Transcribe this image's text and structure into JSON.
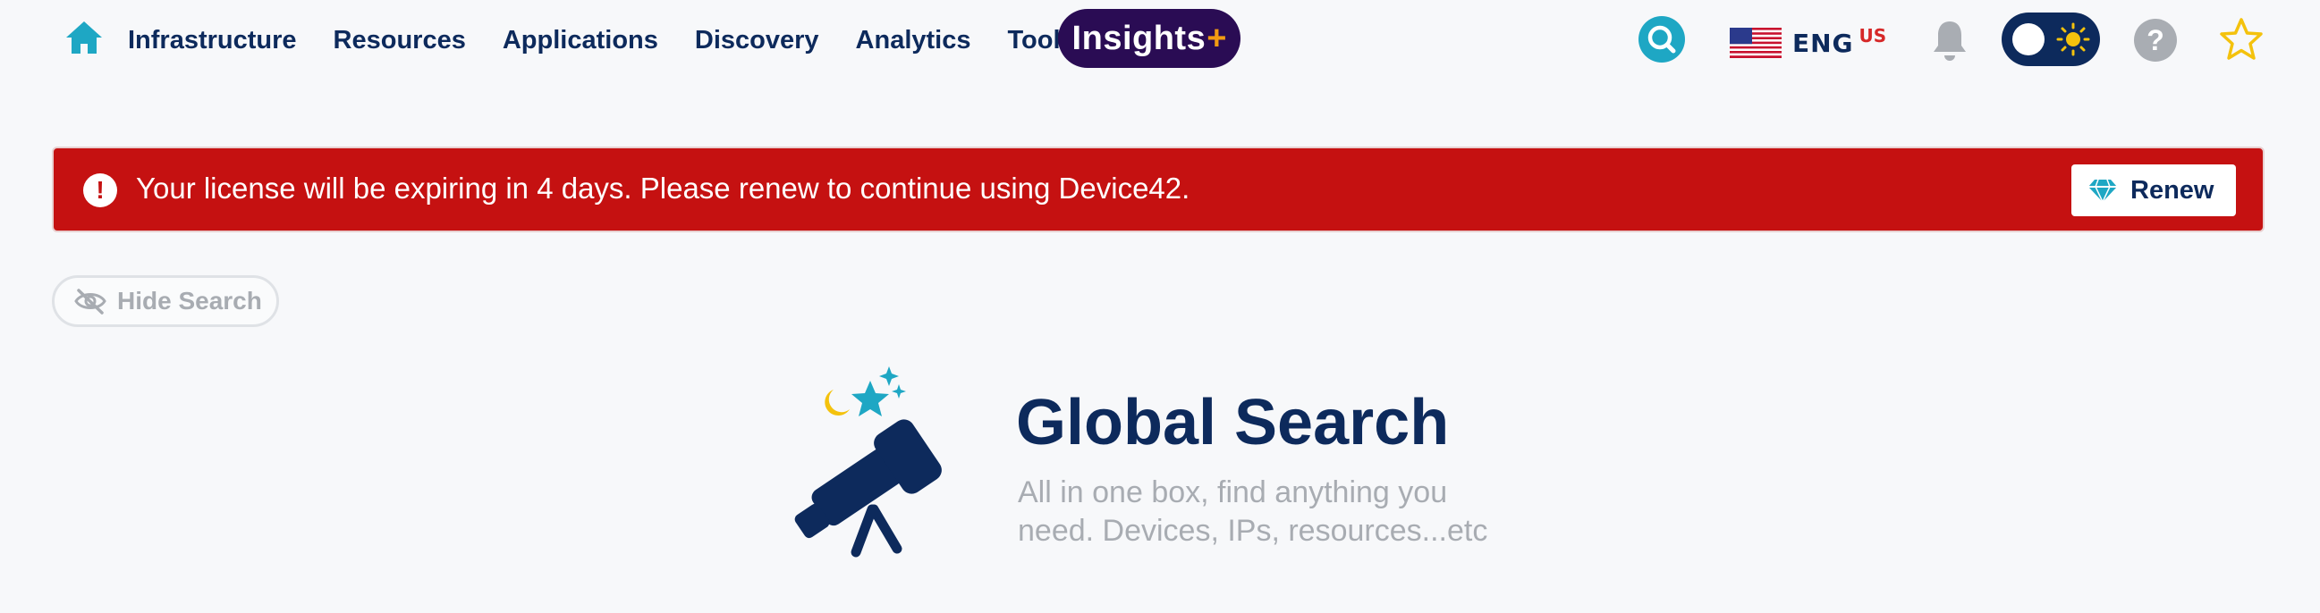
{
  "nav": {
    "home_icon": "home-icon",
    "items": [
      {
        "label": "Infrastructure"
      },
      {
        "label": "Resources"
      },
      {
        "label": "Applications"
      },
      {
        "label": "Discovery"
      },
      {
        "label": "Analytics"
      },
      {
        "label": "Tools"
      }
    ],
    "insights_label": "Insights",
    "insights_plus": "+"
  },
  "header_right": {
    "search_icon": "search-icon",
    "flag_icon": "us-flag-icon",
    "language_code": "ENG",
    "language_region": "US",
    "bell_icon": "bell-icon",
    "theme_icon": "sun-icon",
    "help_label": "?",
    "favorite_icon": "star-icon"
  },
  "banner": {
    "icon_label": "!",
    "message": "Your license will be expiring in 4 days. Please renew to continue using Device42.",
    "renew_label": "Renew",
    "renew_icon": "diamond-icon"
  },
  "hide_search": {
    "label": "Hide Search",
    "icon": "eye-slash-icon"
  },
  "hero": {
    "title": "Global Search",
    "subtitle_line1": "All in one box, find anything you",
    "subtitle_line2": "need. Devices, IPs, resources...etc",
    "illustration": "telescope-icon"
  },
  "colors": {
    "navy": "#0d2a5c",
    "teal": "#1ea7c4",
    "banner_red": "#c51111",
    "insights_bg": "#2a0c54",
    "insights_plus": "#f39c12",
    "muted_gray": "#a8acb2",
    "star_yellow": "#f4c20d"
  }
}
